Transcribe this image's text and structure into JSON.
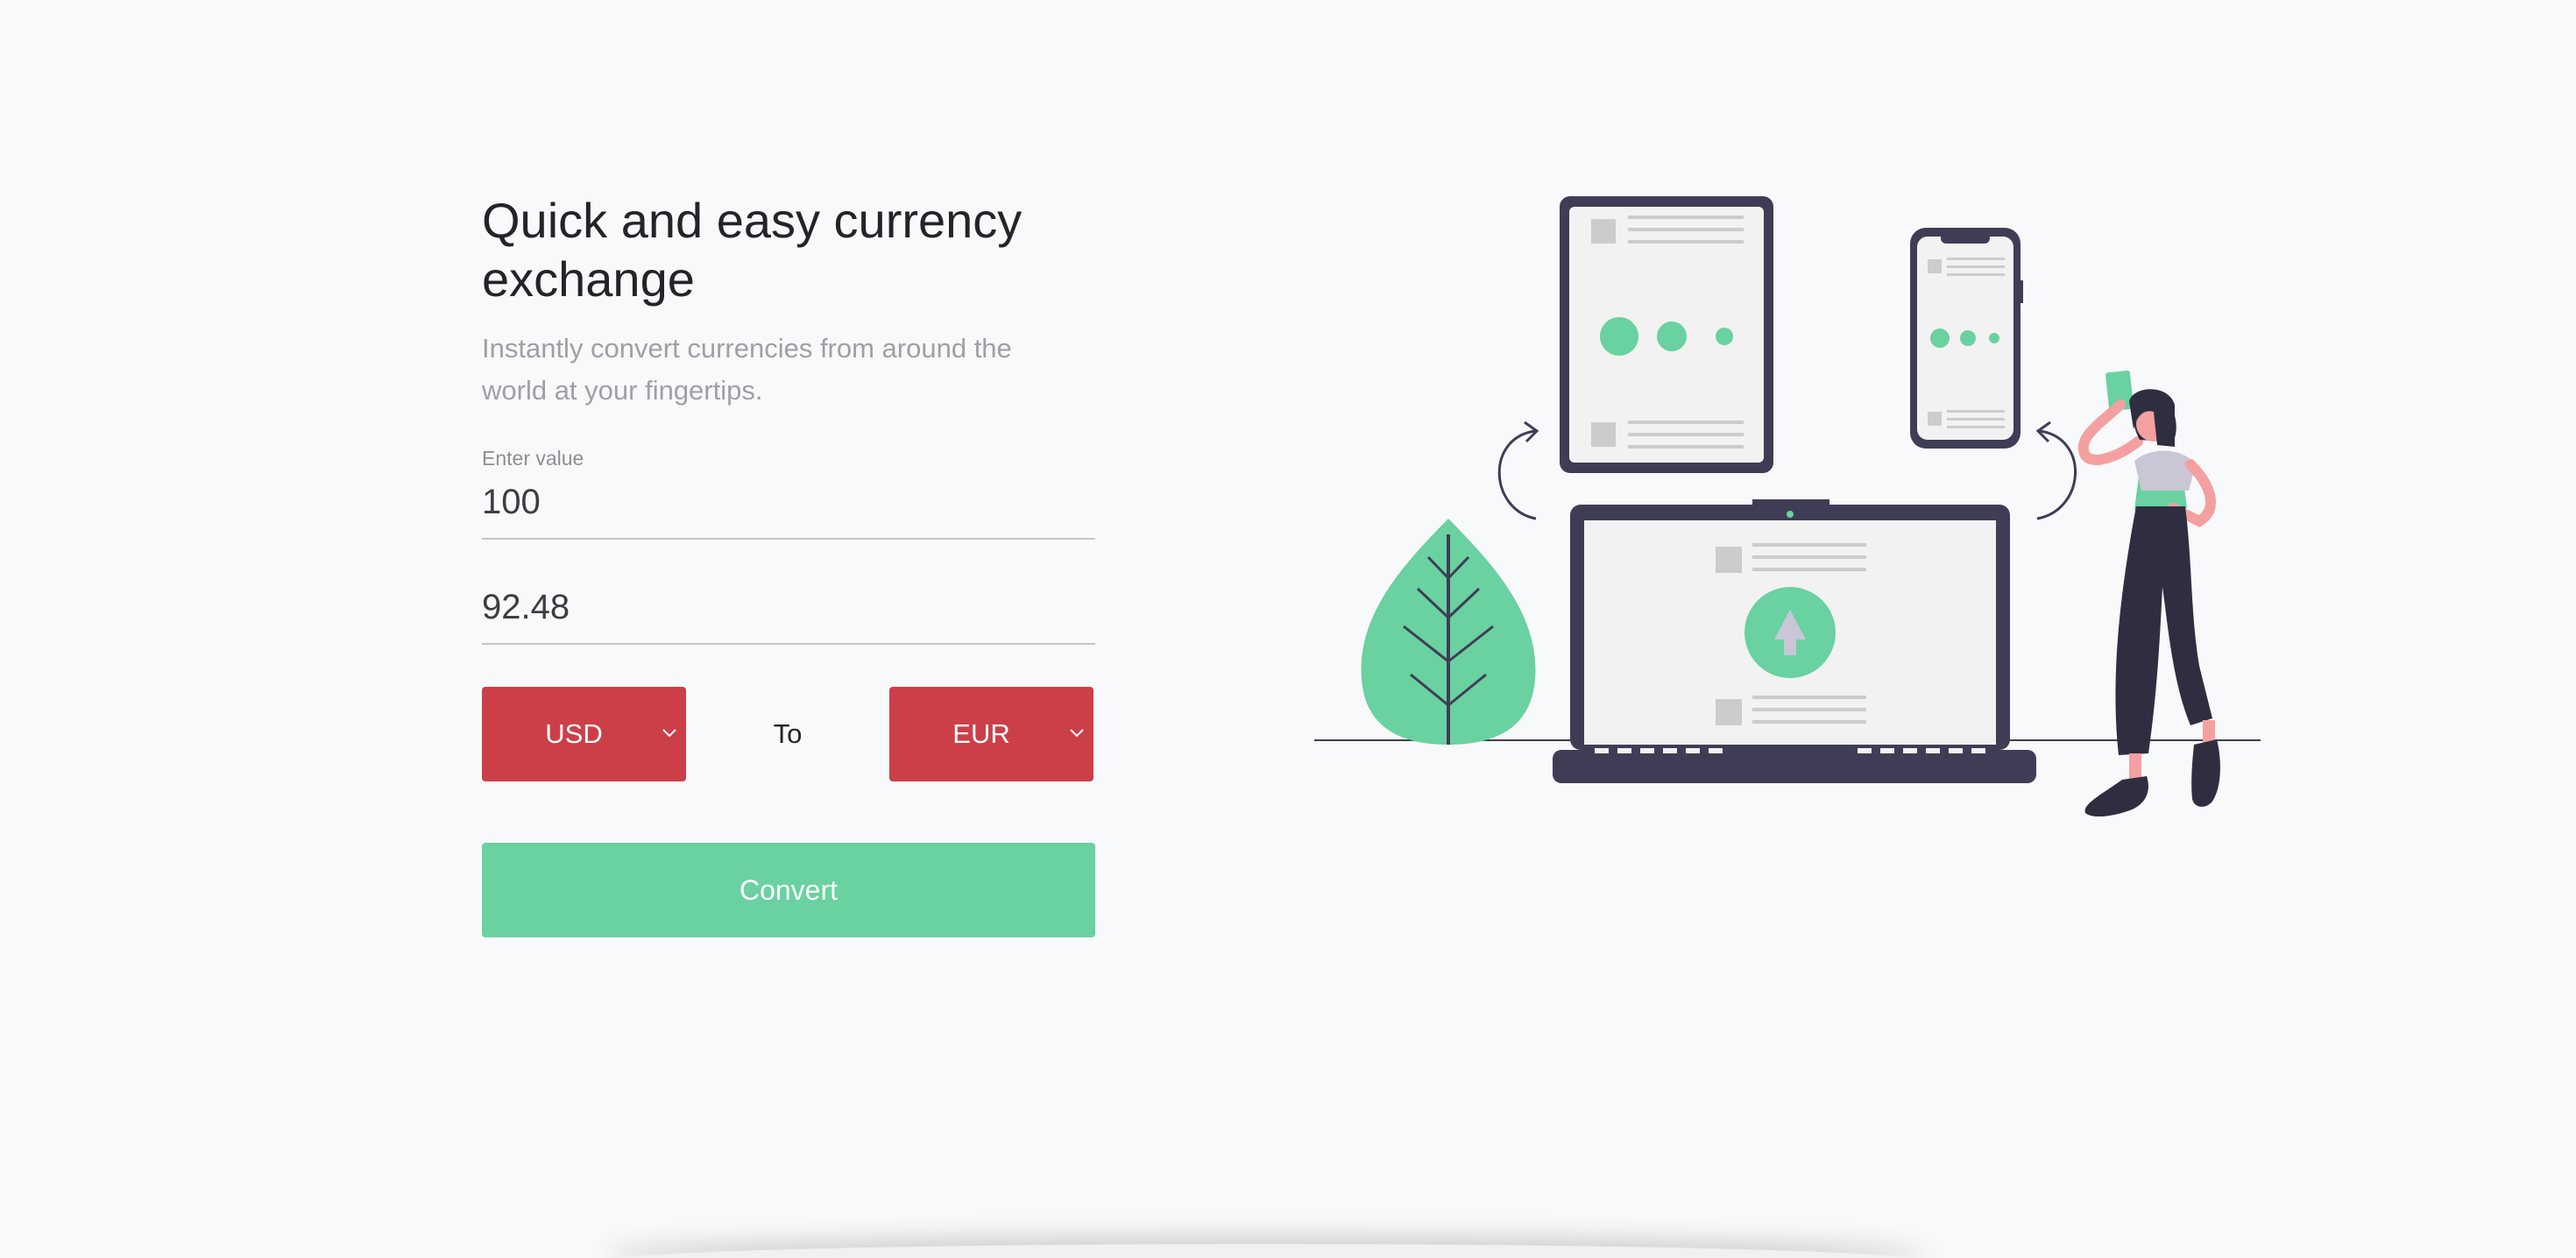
{
  "header": {
    "title": "Quick and easy currency exchange",
    "subtitle": "Instantly convert currencies from around the world at your fingertips."
  },
  "form": {
    "amount_label": "Enter value",
    "amount_value": "100",
    "result_value": "92.48",
    "from_currency": "USD",
    "to_label": "To",
    "to_currency": "EUR",
    "convert_label": "Convert"
  },
  "colors": {
    "accent_red": "#cc3f49",
    "accent_green": "#6ad1a0",
    "background": "#f8f9fb",
    "illustration_dark": "#3f3d56"
  },
  "icons": {
    "dropdown": "chevron-down-icon",
    "illustration": "online-devices-illustration"
  }
}
